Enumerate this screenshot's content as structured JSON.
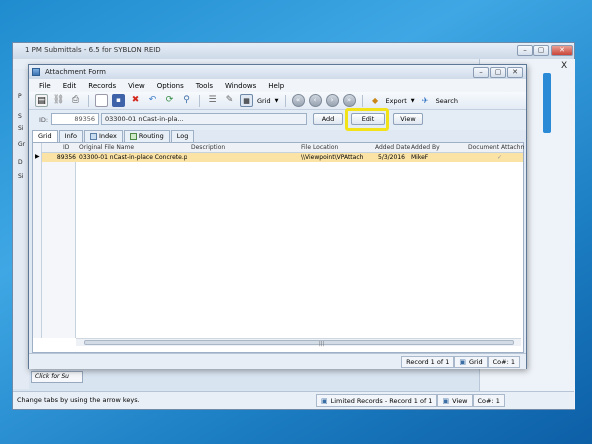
{
  "background_window": {
    "title": "1 PM Submittals - 6.5 for SYBLON REID",
    "close_x": "X",
    "left_strip_letters": [
      "P",
      "S",
      "Si",
      "Gr",
      "D",
      "Si"
    ],
    "click_button": "Click for Su",
    "status_text": "Change tabs by using the arrow keys.",
    "status_records": "Limited Records - Record 1 of 1",
    "status_view": "View",
    "status_co": "Co#: 1"
  },
  "window": {
    "title": "Attachment Form",
    "menu": [
      "File",
      "Edit",
      "Records",
      "View",
      "Options",
      "Tools",
      "Windows",
      "Help"
    ],
    "toolbar": {
      "grid_label": "Grid",
      "export_label": "Export",
      "search_label": "Search"
    },
    "id_label": "ID:",
    "id_value": "89356",
    "id_description": "03300-01 nCast-in-pla...",
    "buttons": {
      "add": "Add",
      "edit": "Edit",
      "view": "View"
    },
    "tabs": [
      "Grid",
      "Info",
      "Index",
      "Routing",
      "Log"
    ],
    "grid": {
      "columns": [
        "ID",
        "Original File Name",
        "Description",
        "File Location",
        "Added Date",
        "Added By",
        "Document Attachme"
      ],
      "rows": [
        {
          "id": "89356",
          "file_name": "03300-01 nCast-in-place Concrete.pdf",
          "description": "",
          "location": "\\\\Viewpoint\\VPAttachr",
          "added_date": "5/3/2016",
          "added_by": "MikeF",
          "attached": "✓"
        }
      ]
    },
    "status": {
      "record": "Record 1 of 1",
      "grid": "Grid",
      "co": "Co#: 1"
    }
  },
  "colors": {
    "highlight": "#f2e21a",
    "selected_row": "#fbe3a6",
    "desktop": "#1f8ccf"
  }
}
